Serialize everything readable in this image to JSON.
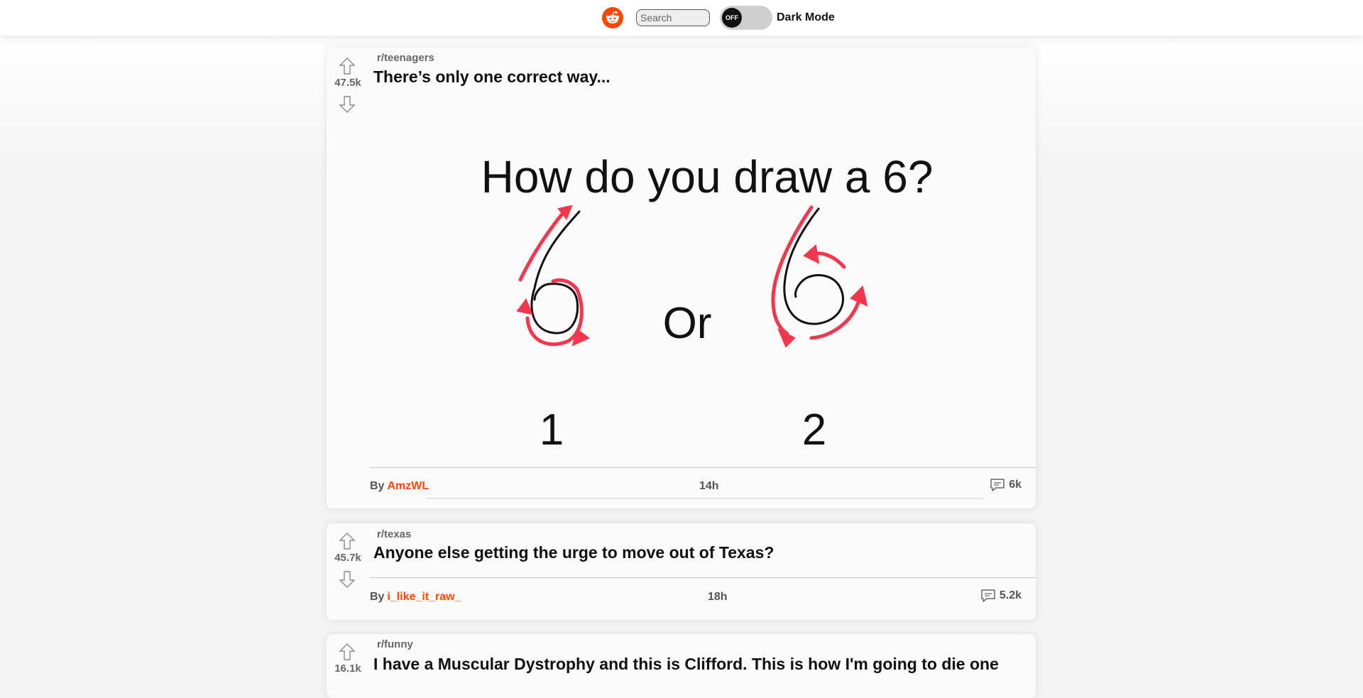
{
  "header": {
    "search_placeholder": "Search",
    "toggle_state": "OFF",
    "dark_mode_label": "Dark Mode"
  },
  "colors": {
    "accent": "#ff4500",
    "annotation_red": "#f4364c"
  },
  "posts": [
    {
      "score": "47.5k",
      "subreddit": "r/teenagers",
      "title": "There’s only one correct way...",
      "author_prefix": "By",
      "author": "AmzWL",
      "time": "14h",
      "comments": "6k",
      "image": {
        "question": "How do you draw a 6?",
        "or": "Or",
        "option1": "1",
        "option2": "2"
      }
    },
    {
      "score": "45.7k",
      "subreddit": "r/texas",
      "title": "Anyone else getting the urge to move out of Texas?",
      "author_prefix": "By",
      "author": "i_like_it_raw_",
      "time": "18h",
      "comments": "5.2k"
    },
    {
      "score": "16.1k",
      "subreddit": "r/funny",
      "title": "I have a Muscular Dystrophy and this is Clifford. This is how I'm going to die one"
    }
  ]
}
